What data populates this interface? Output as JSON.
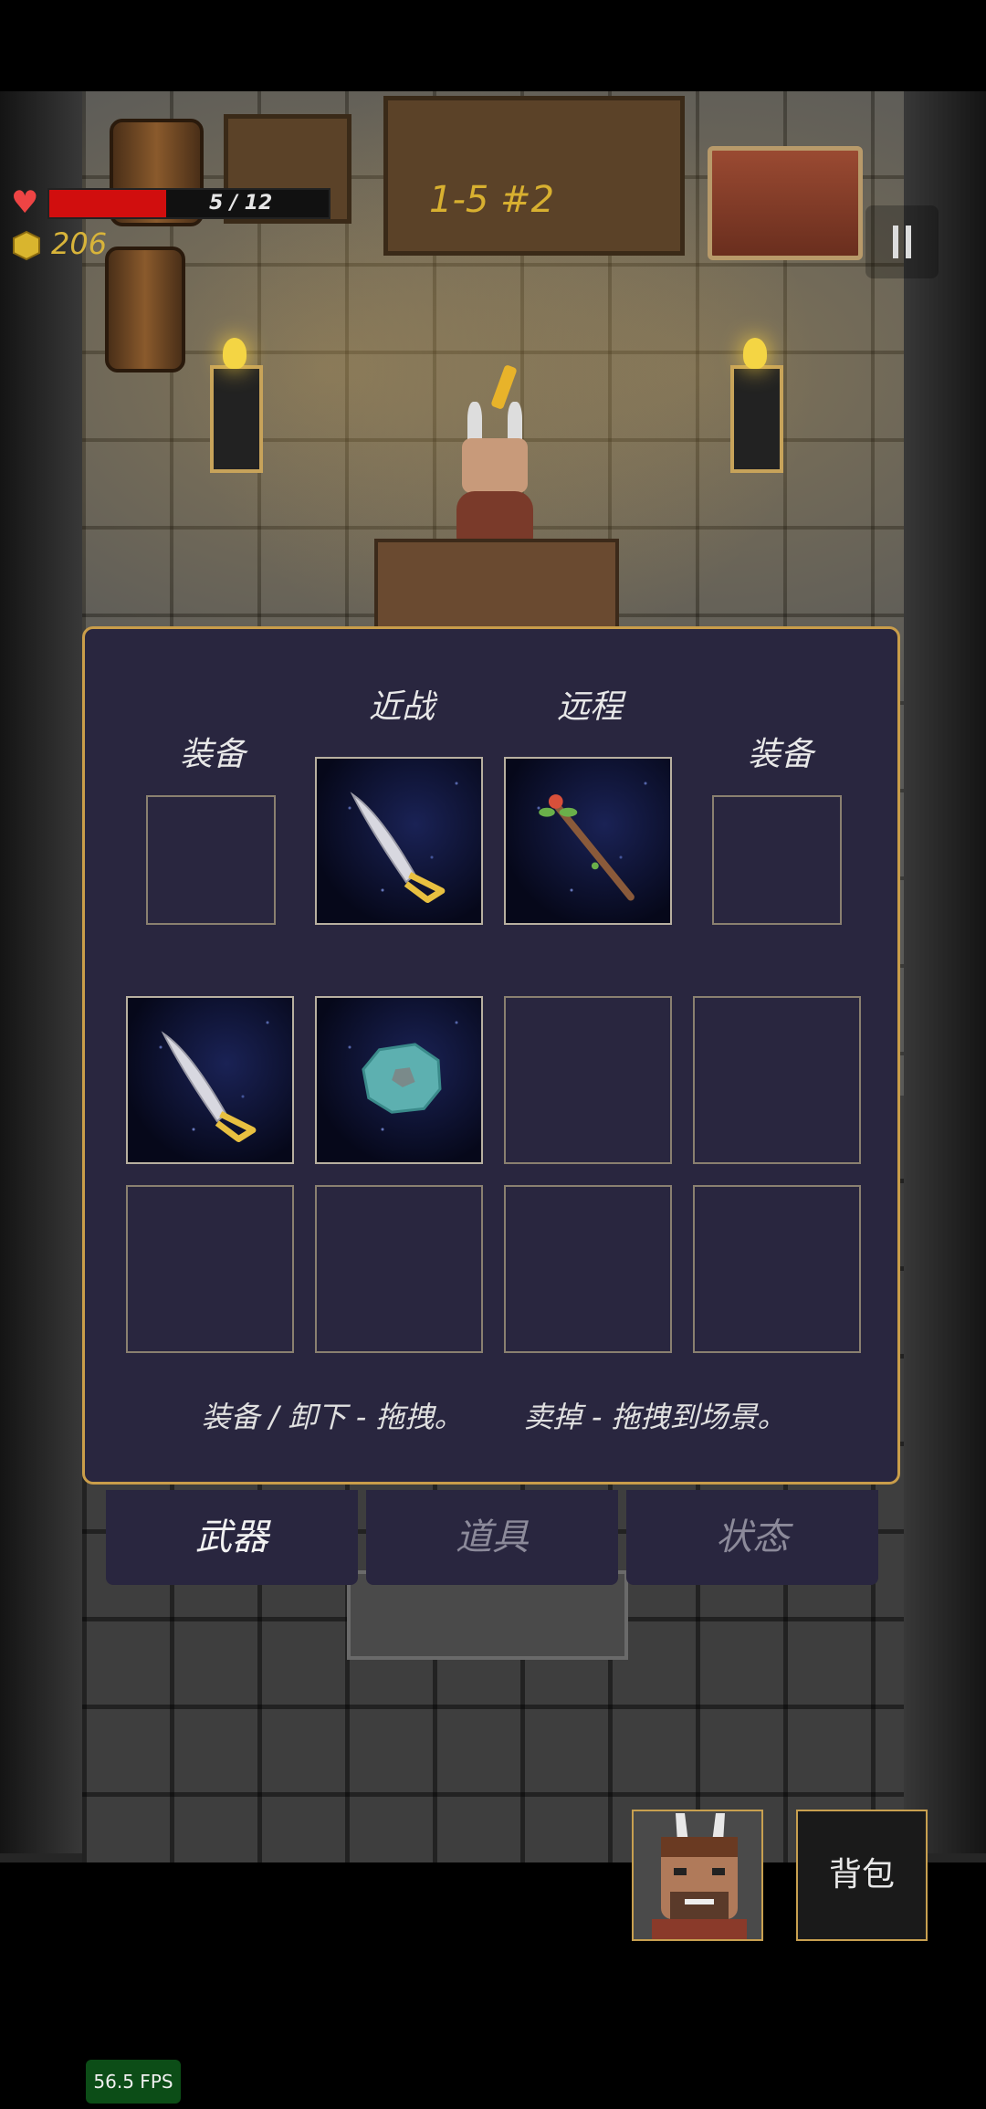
{
  "hud": {
    "health_text": "5 / 12",
    "health_fraction": 0.4167,
    "gold": "206",
    "level": "1-5 #2",
    "health_icon": "heart-icon",
    "gold_icon": "coin-icon",
    "pause_icon": "pause-icon"
  },
  "inventory": {
    "labels": {
      "left_equip": "装备",
      "melee": "近战",
      "ranged": "远程",
      "right_equip": "装备"
    },
    "equip_slots": [
      {
        "item": null
      },
      {
        "item": "sword-icon"
      },
      {
        "item": "staff-icon"
      },
      {
        "item": null
      }
    ],
    "bag_slots": [
      {
        "item": "sword-icon"
      },
      {
        "item": "stone-icon"
      },
      {
        "item": null
      },
      {
        "item": null
      },
      {
        "item": null
      },
      {
        "item": null
      },
      {
        "item": null
      },
      {
        "item": null
      }
    ],
    "help": {
      "equip_hint": "装备 / 卸下 - 拖拽。",
      "sell_hint": "卖掉 - 拖拽到场景。"
    }
  },
  "tabs": [
    {
      "label": "武器",
      "active": true
    },
    {
      "label": "道具",
      "active": false
    },
    {
      "label": "状态",
      "active": false
    }
  ],
  "bottom": {
    "backpack_label": "背包"
  },
  "fps": "56.5 FPS",
  "colors": {
    "panel_bg": "#29263f",
    "panel_border": "#c99d4a",
    "health_red": "#d10e0e",
    "gold": "#d8b43a"
  }
}
